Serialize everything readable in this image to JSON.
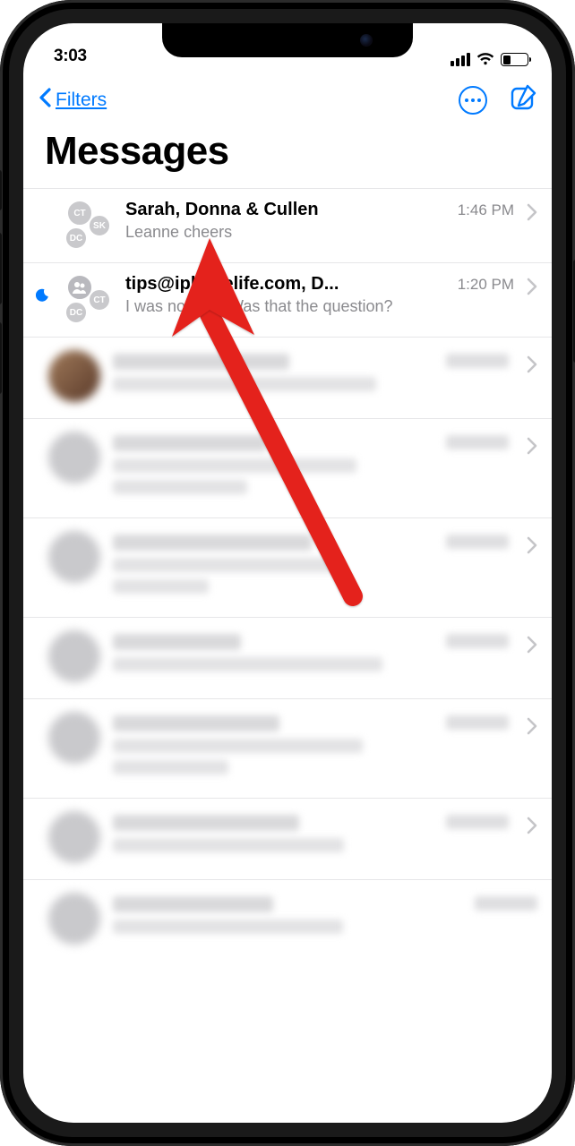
{
  "status": {
    "time": "3:03"
  },
  "nav": {
    "back_label": "Filters"
  },
  "page": {
    "title": "Messages"
  },
  "conversations": [
    {
      "title": "Sarah, Donna & Cullen",
      "time": "1:46 PM",
      "preview": "Leanne cheers",
      "avatar_initials": [
        "CT",
        "SK",
        "DC"
      ],
      "dnd": false
    },
    {
      "title": "tips@iphonelife.com, D...",
      "time": "1:20 PM",
      "preview": "I was notified! Was that the question?",
      "avatar_initials": [
        "CT",
        "",
        "DC"
      ],
      "dnd": true
    }
  ]
}
